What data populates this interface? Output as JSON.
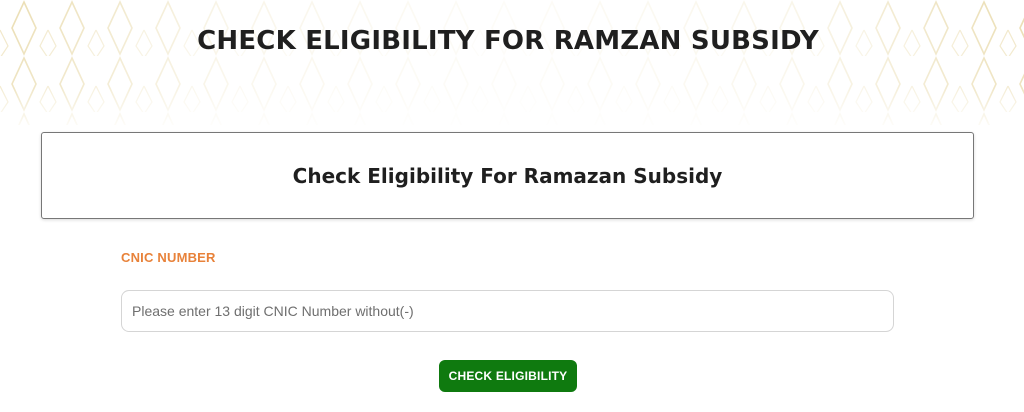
{
  "hero": {
    "title": "CHECK ELIGIBILITY FOR RAMZAN SUBSIDY"
  },
  "card": {
    "title": "Check Eligibility For Ramazan Subsidy"
  },
  "form": {
    "cnic_label": "CNIC NUMBER",
    "cnic_value": "",
    "cnic_placeholder": "Please enter 13 digit CNIC Number without(-)",
    "submit_label": "CHECK ELIGIBILITY"
  },
  "colors": {
    "label_accent": "#e8823a",
    "button_green": "#0f7a0f",
    "pattern_gold": "#e8d9a8"
  }
}
